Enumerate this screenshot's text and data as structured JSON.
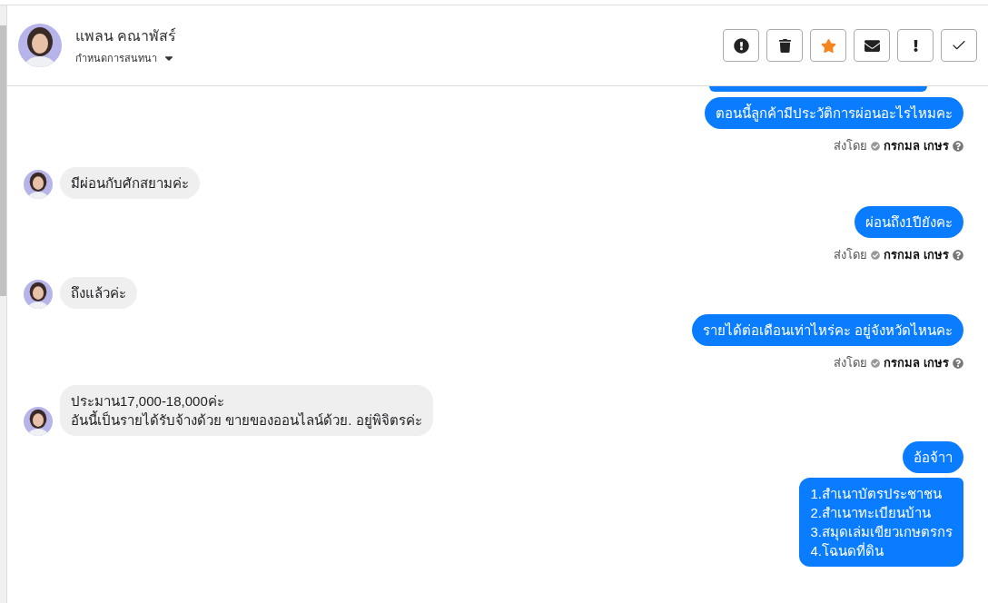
{
  "contact": {
    "name": "แพลน คณาพัสร์",
    "subtitle": "กำหนดการสนทนา"
  },
  "toolbar": [
    {
      "kind": "alert"
    },
    {
      "kind": "trash"
    },
    {
      "kind": "star",
      "on": true
    },
    {
      "kind": "mail"
    },
    {
      "kind": "important"
    },
    {
      "kind": "done"
    }
  ],
  "messages": [
    {
      "kind": "cut"
    },
    {
      "kind": "outgoing",
      "lines": [
        "ตอนนี้ลูกค้ามีประวัติการผ่อนอะไรไหมคะ"
      ],
      "meta": {
        "label": "ส่งโดย",
        "sender": "กรกมล เกษร"
      }
    },
    {
      "kind": "incoming",
      "lines": [
        "มีผ่อนกับศักสยามค่ะ"
      ]
    },
    {
      "kind": "outgoing",
      "lines": [
        "ผ่อนถึง1ปียังคะ"
      ],
      "meta": {
        "label": "ส่งโดย",
        "sender": "กรกมล เกษร"
      }
    },
    {
      "kind": "incoming",
      "lines": [
        "ถึงแล้วค่ะ"
      ]
    },
    {
      "kind": "outgoing",
      "lines": [
        "รายได้ต่อเดือนเท่าไหร่คะ อยู่จังหวัดไหนคะ"
      ],
      "meta": {
        "label": "ส่งโดย",
        "sender": "กรกมล เกษร"
      }
    },
    {
      "kind": "incoming",
      "lines": [
        "ประมาน17,000-18,000ค่ะ",
        "อันนี้เป็นรายได้รับจ้างด้วย ขายของออนไลน์ด้วย. อยู่พิจิตรค่ะ"
      ]
    },
    {
      "kind": "outgoing",
      "lines": [
        "อ้อจ้าา"
      ]
    },
    {
      "kind": "outgoing",
      "lines": [
        "1.สำเนาบัตรประชาชน",
        "2.สำเนาทะเบียนบ้าน",
        "3.สมุดเล่มเขียวเกษตรกร",
        "4.โฉนดที่ดิน"
      ]
    }
  ]
}
